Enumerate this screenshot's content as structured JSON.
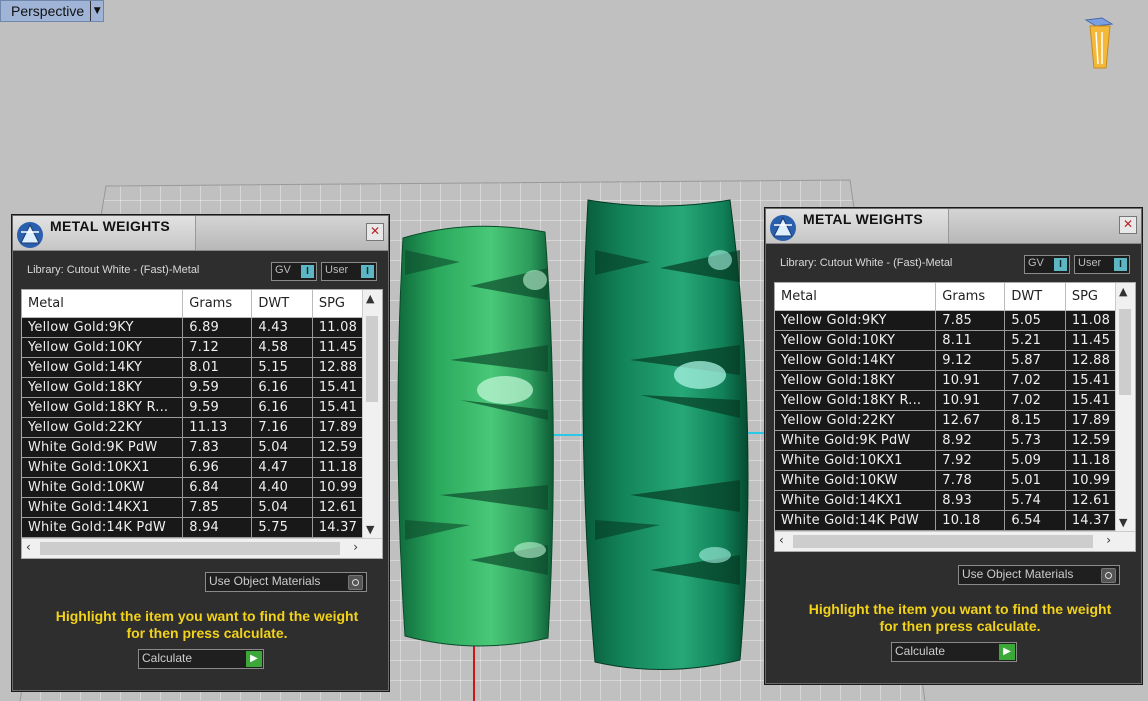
{
  "viewport": {
    "label": "Perspective",
    "accent": "#9fb4d6",
    "ring_colors": [
      "#1f9e62",
      "#0e7a52"
    ]
  },
  "panels": [
    {
      "title": "METAL WEIGHTS",
      "library": "Library: Cutout White - (Fast)-Metal",
      "toggle_gv": "GV",
      "toggle_user": "User",
      "columns": [
        "Metal",
        "Grams",
        "DWT",
        "SPG"
      ],
      "rows": [
        [
          "Yellow Gold:9KY",
          "6.89",
          "4.43",
          "11.08"
        ],
        [
          "Yellow Gold:10KY",
          "7.12",
          "4.58",
          "11.45"
        ],
        [
          "Yellow Gold:14KY",
          "8.01",
          "5.15",
          "12.88"
        ],
        [
          "Yellow Gold:18KY",
          "9.59",
          "6.16",
          "15.41"
        ],
        [
          "Yellow Gold:18KY R...",
          "9.59",
          "6.16",
          "15.41"
        ],
        [
          "Yellow Gold:22KY",
          "11.13",
          "7.16",
          "17.89"
        ],
        [
          "White Gold:9K PdW",
          "7.83",
          "5.04",
          "12.59"
        ],
        [
          "White Gold:10KX1",
          "6.96",
          "4.47",
          "11.18"
        ],
        [
          "White Gold:10KW",
          "6.84",
          "4.40",
          "10.99"
        ],
        [
          "White Gold:14KX1",
          "7.85",
          "5.04",
          "12.61"
        ],
        [
          "White Gold:14K PdW",
          "8.94",
          "5.75",
          "14.37"
        ]
      ],
      "use_object_materials": "Use Object Materials",
      "hint_line1": "Highlight the item you want to find the weight",
      "hint_line2": "for then press calculate.",
      "calculate": "Calculate"
    },
    {
      "title": "METAL WEIGHTS",
      "library": "Library: Cutout White - (Fast)-Metal",
      "toggle_gv": "GV",
      "toggle_user": "User",
      "columns": [
        "Metal",
        "Grams",
        "DWT",
        "SPG"
      ],
      "rows": [
        [
          "Yellow Gold:9KY",
          "7.85",
          "5.05",
          "11.08"
        ],
        [
          "Yellow Gold:10KY",
          "8.11",
          "5.21",
          "11.45"
        ],
        [
          "Yellow Gold:14KY",
          "9.12",
          "5.87",
          "12.88"
        ],
        [
          "Yellow Gold:18KY",
          "10.91",
          "7.02",
          "15.41"
        ],
        [
          "Yellow Gold:18KY R...",
          "10.91",
          "7.02",
          "15.41"
        ],
        [
          "Yellow Gold:22KY",
          "12.67",
          "8.15",
          "17.89"
        ],
        [
          "White Gold:9K PdW",
          "8.92",
          "5.73",
          "12.59"
        ],
        [
          "White Gold:10KX1",
          "7.92",
          "5.09",
          "11.18"
        ],
        [
          "White Gold:10KW",
          "7.78",
          "5.01",
          "10.99"
        ],
        [
          "White Gold:14KX1",
          "8.93",
          "5.74",
          "12.61"
        ],
        [
          "White Gold:14K PdW",
          "10.18",
          "6.54",
          "14.37"
        ]
      ],
      "use_object_materials": "Use Object Materials",
      "hint_line1": "Highlight the item you want to find the weight",
      "hint_line2": "for then press calculate.",
      "calculate": "Calculate"
    }
  ]
}
